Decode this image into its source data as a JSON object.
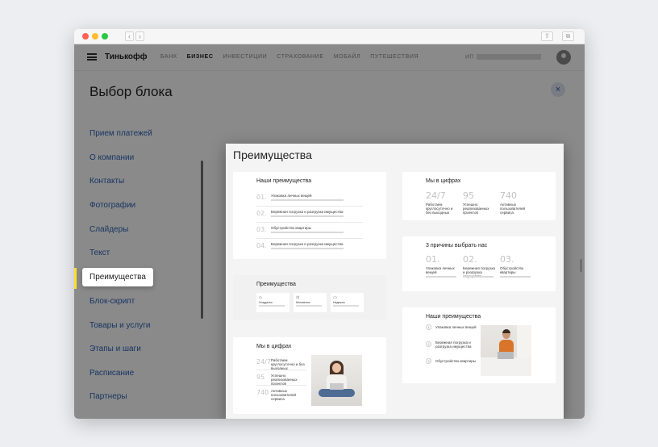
{
  "site": {
    "logo": "Тинькофф",
    "nav": [
      "БАНК",
      "БИЗНЕС",
      "ИНВЕСТИЦИИ",
      "СТРАХОВАНИЕ",
      "МОБАЙЛ",
      "ПУТЕШЕСТВИЯ"
    ],
    "active_nav": "БИЗНЕС",
    "account_prefix": "ИП"
  },
  "panel": {
    "title": "Выбор блока",
    "close": "×",
    "menu": [
      "Прием платежей",
      "О компании",
      "Контакты",
      "Фотографии",
      "Слайдеры",
      "Текст",
      "Преимущества",
      "Блок-скрипт",
      "Товары и услуги",
      "Этапы и шаги",
      "Расписание",
      "Партнеры"
    ],
    "selected": "Преимущества"
  },
  "preview": {
    "title": "Преимущества",
    "card1": {
      "title": "Наши преимущества",
      "items": [
        {
          "num": "01.",
          "text": "Упаковка личных вещей"
        },
        {
          "num": "02.",
          "text": "Бережная погрузка и разгрузка имущества"
        },
        {
          "num": "03.",
          "text": "Обустройство квартиры"
        },
        {
          "num": "04.",
          "text": "Бережная погрузка и разгрузка имущества"
        }
      ]
    },
    "card2": {
      "title": "Преимущества",
      "items": [
        {
          "icon": "◇",
          "text": "Геоудачно"
        },
        {
          "icon": "◷",
          "text": "Мгновенно"
        },
        {
          "icon": "▭",
          "text": "Надежно"
        }
      ]
    },
    "card3": {
      "title": "Мы в цифрах",
      "items": [
        {
          "num": "24/7",
          "text": "Работаем круглосуточно и без выходных"
        },
        {
          "num": "95",
          "text": "Успешно реализованных проектов"
        },
        {
          "num": "740",
          "text": "Активных пользователей сервиса"
        }
      ]
    },
    "card4": {
      "title": "Мы в цифрах",
      "items": [
        {
          "num": "24/7",
          "text": "Работаем круглосуточно и без выходных"
        },
        {
          "num": "95",
          "text": "Успешно реализованных проектов"
        },
        {
          "num": "740",
          "text": "Активных пользователей сервиса"
        }
      ]
    },
    "card5": {
      "title": "3 причины выбрать нас",
      "items": [
        {
          "num": "01.",
          "text": "Упаковка личных вещей"
        },
        {
          "num": "02.",
          "text": "Бережная погрузка и разгрузка имущества"
        },
        {
          "num": "03.",
          "text": "Обустройство квартиры"
        }
      ]
    },
    "card6": {
      "title": "Наши преимущества",
      "items": [
        {
          "num": "1",
          "text": "Упаковка личных вещей"
        },
        {
          "num": "2",
          "text": "Бережная погрузка и разгрузка имущества"
        },
        {
          "num": "3",
          "text": "Обустройство квартиры"
        }
      ]
    }
  },
  "chrome": {
    "back": "‹",
    "forward": "›",
    "share": "⇪",
    "tabs": "⧉"
  }
}
